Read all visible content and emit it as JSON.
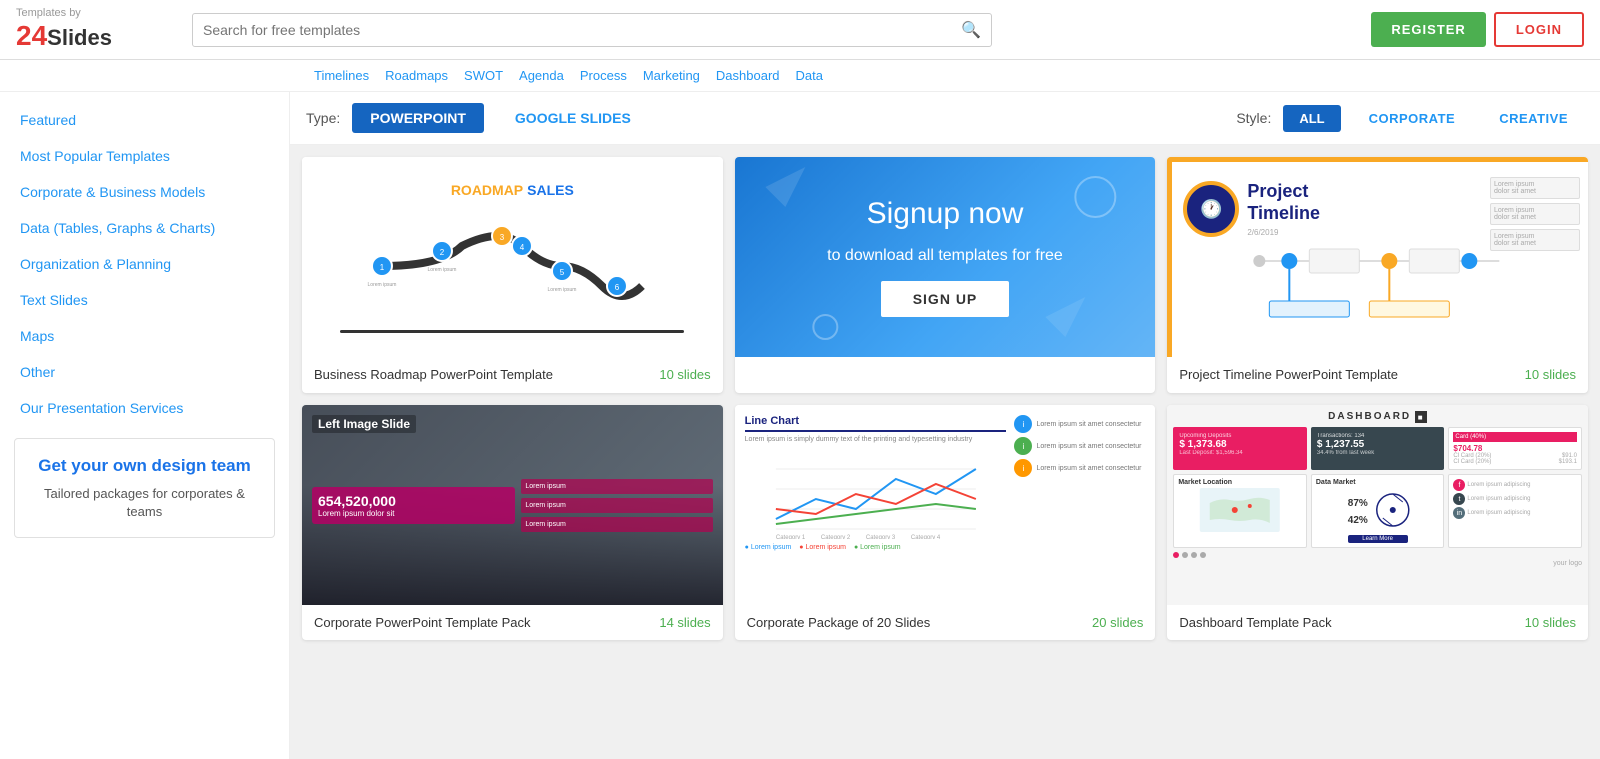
{
  "header": {
    "logo_by": "Templates by",
    "logo_24": "24",
    "logo_slides": "Slides",
    "search_placeholder": "Search for free templates",
    "register_label": "REGISTER",
    "login_label": "LOGIN"
  },
  "nav_tags": [
    "Timelines",
    "Roadmaps",
    "SWOT",
    "Agenda",
    "Process",
    "Marketing",
    "Dashboard",
    "Data"
  ],
  "filter": {
    "type_label": "Type:",
    "powerpoint_label": "POWERPOINT",
    "google_slides_label": "GOOGLE SLIDES",
    "style_label": "Style:",
    "all_label": "ALL",
    "corporate_label": "CORPORATE",
    "creative_label": "CREATIVE"
  },
  "sidebar": {
    "items": [
      {
        "label": "Featured",
        "color": "blue"
      },
      {
        "label": "Most Popular Templates",
        "color": "blue"
      },
      {
        "label": "Corporate & Business Models",
        "color": "blue"
      },
      {
        "label": "Data (Tables, Graphs & Charts)",
        "color": "blue"
      },
      {
        "label": "Organization & Planning",
        "color": "blue"
      },
      {
        "label": "Text Slides",
        "color": "blue"
      },
      {
        "label": "Maps",
        "color": "blue"
      },
      {
        "label": "Other",
        "color": "blue"
      },
      {
        "label": "Our Presentation Services",
        "color": "blue"
      }
    ],
    "promo_title": "Get your own design team",
    "promo_subtitle": "Tailored packages for corporates & teams"
  },
  "cards": [
    {
      "title": "Business Roadmap PowerPoint Template",
      "slides": "10 slides",
      "type": "roadmap"
    },
    {
      "title": "Signup now",
      "subtitle": "to download all templates for free",
      "btn_label": "SIGN UP",
      "type": "signup"
    },
    {
      "title": "Project Timeline PowerPoint Template",
      "slides": "10 slides",
      "type": "timeline"
    },
    {
      "title": "Corporate PowerPoint Template Pack",
      "slides": "14 slides",
      "type": "corporate"
    },
    {
      "title": "Corporate Package of 20 Slides",
      "slides": "20 slides",
      "type": "linechart"
    },
    {
      "title": "Dashboard Template Pack",
      "slides": "10 slides",
      "type": "dashboard"
    }
  ]
}
